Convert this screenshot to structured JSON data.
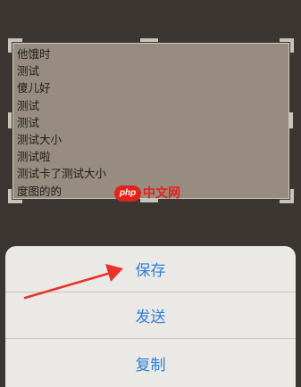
{
  "crop": {
    "lines": [
      "他饿时",
      "测试",
      "傻儿好",
      "测试",
      "测试",
      "测试大小",
      "测试啦",
      "测试卡了测试大小",
      "度图的的"
    ]
  },
  "watermark": {
    "badge": "php",
    "text": "中文网"
  },
  "action_sheet": {
    "items": [
      "保存",
      "发送",
      "复制"
    ]
  },
  "colors": {
    "action_text": "#2f7fd8",
    "arrow": "#e8322b",
    "watermark": "#e2231a"
  }
}
